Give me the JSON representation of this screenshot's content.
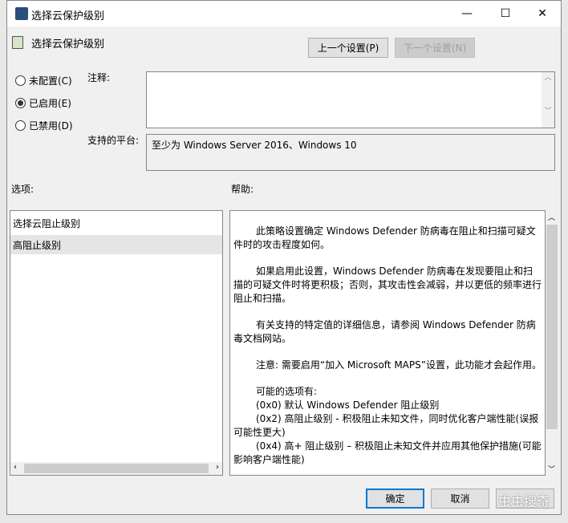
{
  "window": {
    "title": "选择云保护级别",
    "minimize": "—",
    "maximize": "☐",
    "close": "✕"
  },
  "header": {
    "title": "选择云保护级别",
    "prev_button": "上一个设置(P)",
    "next_button": "下一个设置(N)"
  },
  "state": {
    "options": [
      "未配置(C)",
      "已启用(E)",
      "已禁用(D)"
    ],
    "selected": 1
  },
  "comment": {
    "label": "注释:",
    "value": ""
  },
  "platform": {
    "label": "支持的平台:",
    "value": "至少为 Windows Server 2016、Windows 10"
  },
  "options_panel": {
    "label": "选项:",
    "item_label": "选择云阻止级别",
    "dropdown_value": "高阻止级别"
  },
  "help_panel": {
    "label": "帮助:",
    "paragraphs": [
      "此策略设置确定 Windows Defender 防病毒在阻止和扫描可疑文件时的攻击程度如何。",
      "如果启用此设置，Windows Defender 防病毒在发现要阻止和扫描的可疑文件时将更积极；否则，其攻击性会减弱，并以更低的频率进行阻止和扫描。",
      "有关支持的特定值的详细信息，请参阅 Windows Defender 防病毒文档网站。",
      "注意: 需要启用“加入 Microsoft MAPS”设置，此功能才会起作用。"
    ],
    "list_title": "可能的选项有:",
    "list": [
      "(0x0) 默认 Windows Defender 阻止级别",
      "(0x2) 高阻止级别 - 积极阻止未知文件，同时优化客户端性能(误报可能性更大)",
      "(0x4) 高+ 阻止级别 – 积极阻止未知文件并应用其他保护措施(可能影响客户端性能)"
    ]
  },
  "footer": {
    "ok": "确定",
    "cancel": "取消",
    "watermark": "虫虫搜奇"
  }
}
